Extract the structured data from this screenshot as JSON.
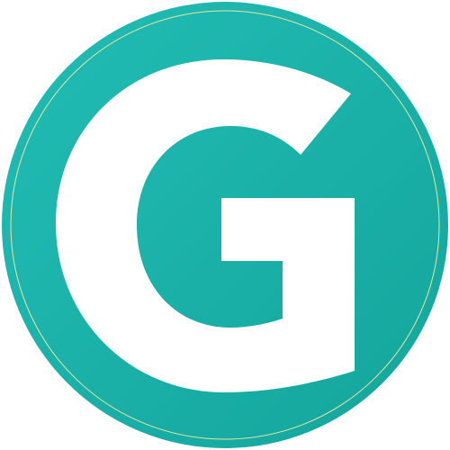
{
  "logo": {
    "letter": "G",
    "colors": {
      "background": "#ffffff",
      "circle_fill_light": "#22bdb5",
      "circle_fill_dark": "#13a59c",
      "ring_stroke": "#e8e6a0",
      "letter_fill": "#ffffff"
    }
  }
}
